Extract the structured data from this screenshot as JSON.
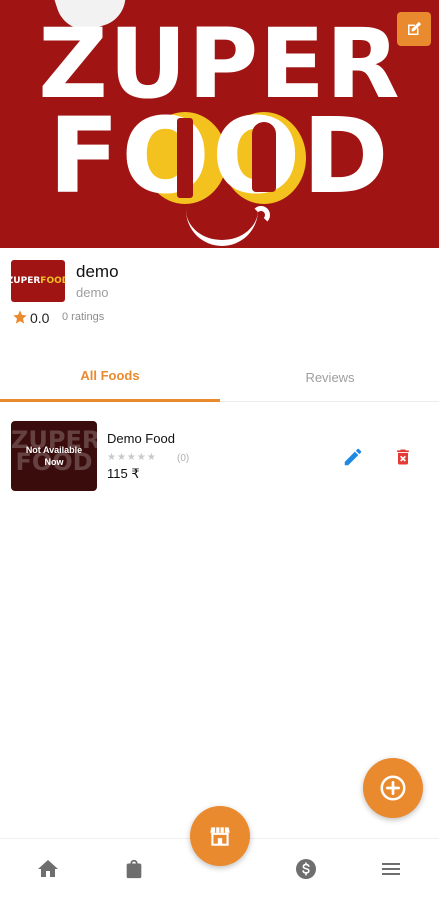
{
  "cover": {
    "brand_line1": "ZUPER",
    "brand_line2": "FOOD"
  },
  "restaurant": {
    "logo_text_a": "ZUPER",
    "logo_text_b": "FOOD",
    "name": "demo",
    "subtitle": "demo",
    "rating": "0.0",
    "rating_count": "0 ratings"
  },
  "tabs": [
    {
      "label": "All Foods",
      "active": true
    },
    {
      "label": "Reviews",
      "active": false
    }
  ],
  "foods": [
    {
      "thumb_ghost_a": "ZUPER",
      "thumb_ghost_b": "FOOD",
      "overlay": "Not Available Now",
      "name": "Demo Food",
      "stars": "★★★★★",
      "review_count": "(0)",
      "price": "115 ₹"
    }
  ],
  "icons": {
    "edit_cover": "edit-square-icon",
    "edit_food": "pencil-icon",
    "delete_food": "trash-icon",
    "fab": "plus-circle-icon",
    "nav": [
      "home-icon",
      "shopping-bag-icon",
      "store-icon",
      "dollar-circle-icon",
      "menu-icon"
    ]
  },
  "colors": {
    "accent": "#ea8a2e",
    "brand_red": "#a01414",
    "brand_yellow": "#f4c21f",
    "edit_blue": "#1e88e5",
    "delete_red": "#e53935",
    "nav_gray": "#6e6e6e"
  }
}
